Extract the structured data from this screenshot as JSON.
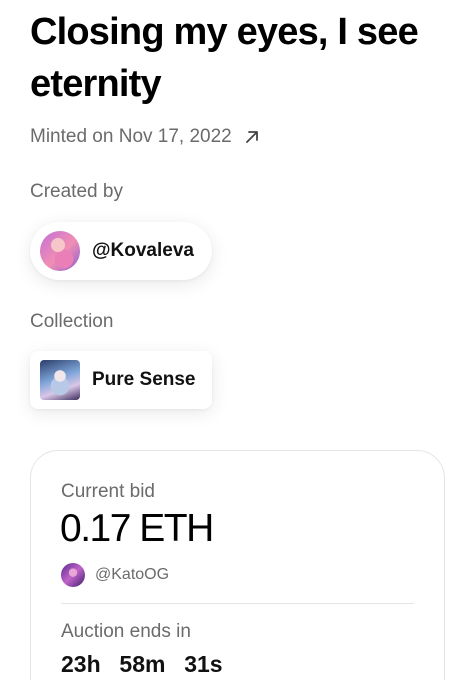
{
  "nft": {
    "title": "Closing my eyes, I see eternity",
    "minted_text": "Minted on Nov 17, 2022",
    "minted_link_icon": "arrow-up-right-icon"
  },
  "creator": {
    "label": "Created by",
    "handle": "@Kovaleva",
    "avatar_icon": "creator-avatar"
  },
  "collection": {
    "label": "Collection",
    "name": "Pure Sense",
    "thumbnail_icon": "collection-thumbnail"
  },
  "auction": {
    "current_bid_label": "Current bid",
    "current_bid_value": "0.17 ETH",
    "bidder_handle": "@KatoOG",
    "ends_label": "Auction ends in",
    "time_remaining": "23h  58m  31s"
  }
}
